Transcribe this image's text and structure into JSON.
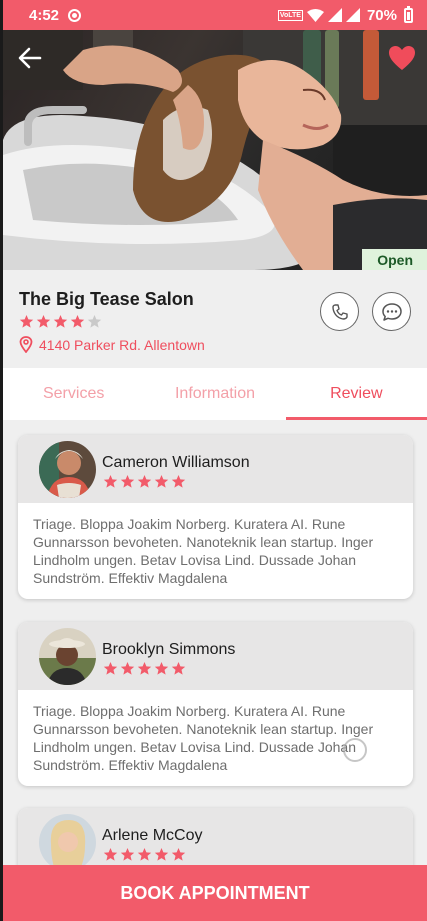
{
  "status_bar": {
    "time": "4:52",
    "volte_label": "VoLTE",
    "battery_percent": "70%"
  },
  "header": {
    "back_icon": "arrow-left-icon",
    "favorite_icon": "heart-icon",
    "favorite_active": true,
    "open_status": "Open"
  },
  "salon": {
    "name": "The Big Tease Salon",
    "rating": 4,
    "rating_max": 5,
    "address": "4140 Parker Rd. Allentown",
    "call_icon": "phone-icon",
    "chat_icon": "chat-bubble-icon"
  },
  "tabs": [
    {
      "label": "Services",
      "active": false
    },
    {
      "label": "Information",
      "active": false
    },
    {
      "label": "Review",
      "active": true
    }
  ],
  "reviews": [
    {
      "name": "Cameron Williamson",
      "rating": 5,
      "text": "Triage. Bloppa Joakim Norberg. Kuratera AI. Rune Gunnarsson bevoheten. Nanoteknik lean startup. Inger Lindholm ungen. Betav Lovisa Lind. Dussade Johan Sundström. Effektiv Magdalena"
    },
    {
      "name": "Brooklyn Simmons",
      "rating": 5,
      "text": "Triage. Bloppa Joakim Norberg. Kuratera AI. Rune Gunnarsson bevoheten. Nanoteknik lean startup. Inger Lindholm ungen. Betav Lovisa Lind. Dussade Johan Sundström. Effektiv Magdalena"
    },
    {
      "name": "Arlene McCoy",
      "rating": 5,
      "text": ""
    }
  ],
  "book_button": "BOOK APPOINTMENT",
  "colors": {
    "accent": "#f25b6a",
    "accent_text": "#ef4e5e",
    "tab_inactive": "#f3a0a8",
    "open_badge_bg": "#dff2dc",
    "star_empty": "#c9c9c9"
  }
}
